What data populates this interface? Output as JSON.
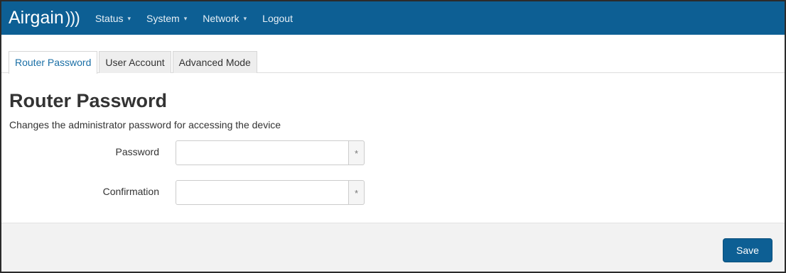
{
  "brand": {
    "name": "Airgain",
    "waves": ")))"
  },
  "nav": {
    "items": [
      {
        "label": "Status",
        "dropdown": true
      },
      {
        "label": "System",
        "dropdown": true
      },
      {
        "label": "Network",
        "dropdown": true
      },
      {
        "label": "Logout",
        "dropdown": false
      }
    ],
    "caret": "▾"
  },
  "tabs": [
    {
      "label": "Router Password",
      "active": true
    },
    {
      "label": "User Account",
      "active": false
    },
    {
      "label": "Advanced Mode",
      "active": false
    }
  ],
  "page": {
    "title": "Router Password",
    "description": "Changes the administrator password for accessing the device"
  },
  "form": {
    "password": {
      "label": "Password",
      "value": "",
      "addon": "*"
    },
    "confirmation": {
      "label": "Confirmation",
      "value": "",
      "addon": "*"
    }
  },
  "footer": {
    "save_label": "Save"
  },
  "colors": {
    "primary": "#0d5f94",
    "active_tab_text": "#1a6fa6",
    "footer_bg": "#f2f2f2"
  }
}
